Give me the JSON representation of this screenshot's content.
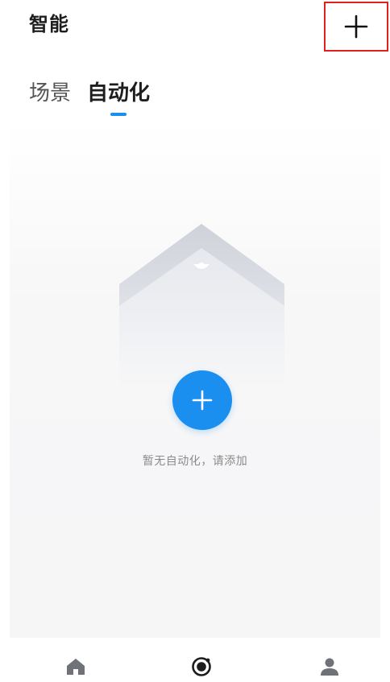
{
  "header": {
    "title": "智能",
    "add_icon": "plus-icon"
  },
  "tabs": [
    {
      "label": "场景",
      "active": false
    },
    {
      "label": "自动化",
      "active": true
    }
  ],
  "accent_color": "#1b8ff0",
  "empty_state": {
    "illustration": "moon-house-illustration",
    "add_icon": "plus-icon",
    "message": "暂无自动化，请添加"
  },
  "bottom_nav": [
    {
      "icon": "home-icon",
      "active": false
    },
    {
      "icon": "smart-icon",
      "active": true
    },
    {
      "icon": "profile-icon",
      "active": false
    }
  ]
}
